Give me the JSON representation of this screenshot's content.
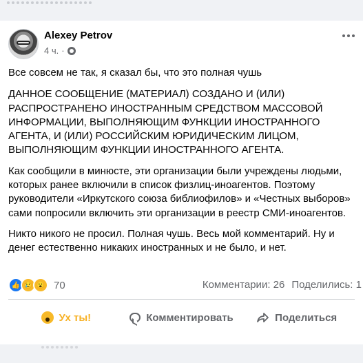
{
  "post": {
    "author": "Alexey Petrov",
    "time": "4 ч.",
    "separator": "·",
    "paragraphs": [
      "Все совсем не так, я сказал бы, что это полная чушь",
      "ДАННОЕ СООБЩЕНИЕ (МАТЕРИАЛ) СОЗДАНО И (ИЛИ) РАСПРОСТРАНЕНО ИНОСТРАННЫМ СРЕДСТВОМ МАССОВОЙ ИНФОРМАЦИИ, ВЫПОЛНЯЮЩИМ ФУНКЦИИ ИНОСТРАННОГО АГЕНТА, И (ИЛИ) РОССИЙСКИМ ЮРИДИЧЕСКИМ ЛИЦОМ, ВЫПОЛНЯЮЩИМ ФУНКЦИИ ИНОСТРАННОГО АГЕНТА.",
      "Как сообщили в минюсте, эти организации были учреждены людьми, которых ранее включили в список физлиц-иноагентов. Поэтому руководители «Иркутского союза библиофилов» и «Честных выборов» сами попросили включить эти организации в реестр СМИ-иноагентов.",
      "Никто никого не просил. Полная чушь. Весь мой комментарий. Ну и денег естественно никаких иностранных и не было, и нет."
    ]
  },
  "reactions": {
    "count": "70",
    "icons": [
      "like-icon",
      "sad-icon",
      "wow-icon"
    ],
    "like_glyph": "👍",
    "sad_glyph": "😢",
    "wow_glyph": "😮"
  },
  "stats": {
    "comments": "Комментарии: 26",
    "shares": "Поделились: 1"
  },
  "actions": {
    "react_label": "Ух ты!",
    "comment_label": "Комментировать",
    "share_label": "Поделиться"
  },
  "colors": {
    "active_reaction": "#f7b125",
    "muted_text": "#65676b",
    "like_blue": "#1877f2"
  }
}
